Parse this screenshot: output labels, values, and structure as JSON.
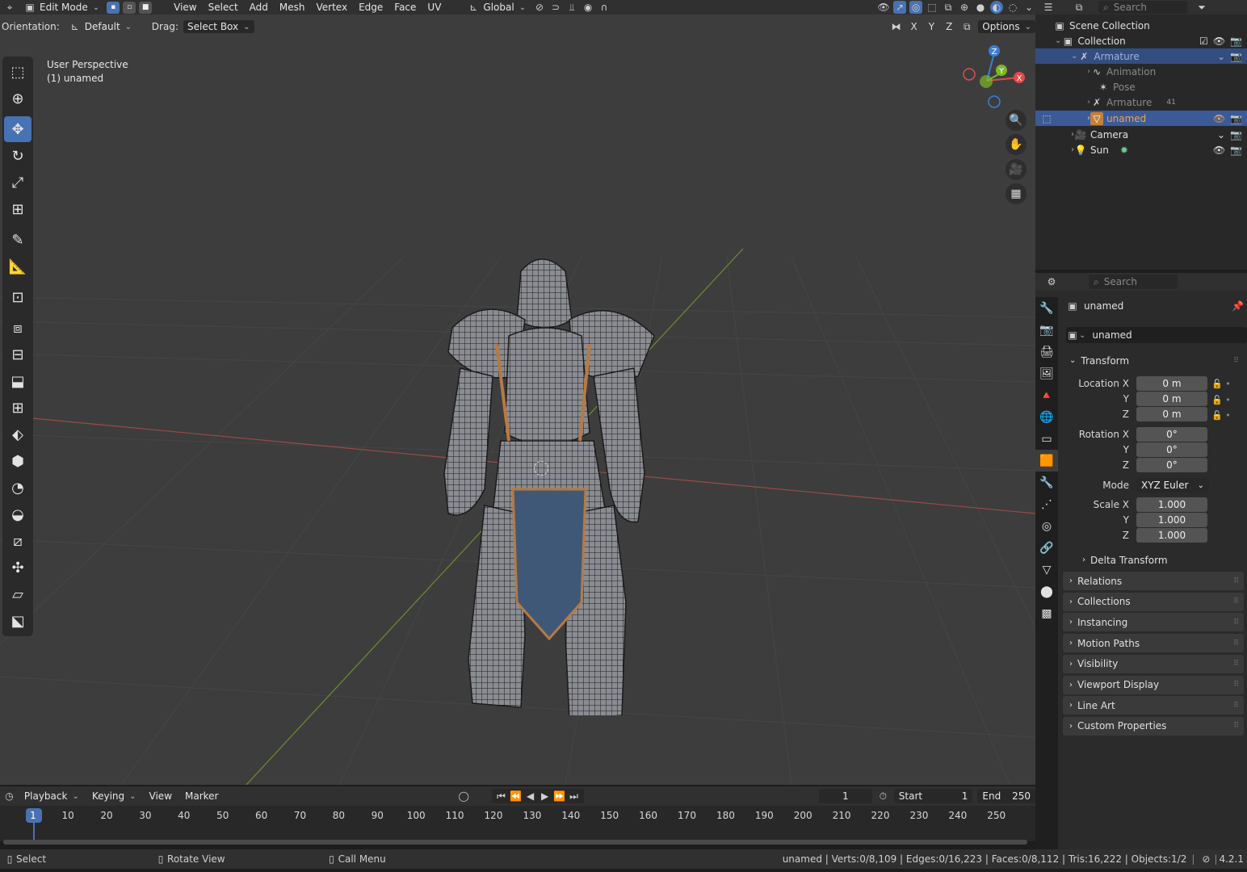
{
  "menu": {
    "mode": "Edit Mode",
    "items": [
      "View",
      "Select",
      "Add",
      "Mesh",
      "Vertex",
      "Edge",
      "Face",
      "UV"
    ],
    "transform_orientation": "Global"
  },
  "header2": {
    "orientation_label": "Orientation:",
    "orientation_value": "Default",
    "drag_label": "Drag:",
    "drag_value": "Select Box",
    "axes": [
      "X",
      "Y",
      "Z"
    ],
    "options": "Options"
  },
  "viewport": {
    "view_name": "User Perspective",
    "object_label": "(1) unamed",
    "gizmo": {
      "x": "X",
      "y": "Y",
      "z": "Z"
    }
  },
  "outliner": {
    "search_placeholder": "Search",
    "scene_collection": "Scene Collection",
    "collection": "Collection",
    "armature": "Armature",
    "animation": "Animation",
    "pose": "Pose",
    "armature_data": "Armature",
    "armature_count": "41",
    "object": "unamed",
    "camera": "Camera",
    "sun": "Sun"
  },
  "properties": {
    "search_placeholder": "Search",
    "object_name": "unamed",
    "datablock_name": "unamed",
    "transform_title": "Transform",
    "location_label": "Location X",
    "rotation_label": "Rotation X",
    "scale_label": "Scale X",
    "y": "Y",
    "z": "Z",
    "location": [
      "0 m",
      "0 m",
      "0 m"
    ],
    "rotation": [
      "0°",
      "0°",
      "0°"
    ],
    "mode_label": "Mode",
    "mode_value": "XYZ Euler",
    "scale": [
      "1.000",
      "1.000",
      "1.000"
    ],
    "delta_transform": "Delta Transform",
    "panels": [
      "Relations",
      "Collections",
      "Instancing",
      "Motion Paths",
      "Visibility",
      "Viewport Display",
      "Line Art",
      "Custom Properties"
    ]
  },
  "timeline": {
    "menus": [
      "Playback",
      "Keying",
      "View",
      "Marker"
    ],
    "current_frame": "1",
    "start_label": "Start",
    "start": "1",
    "end_label": "End",
    "end": "250",
    "ticks": [
      "1",
      "10",
      "20",
      "30",
      "40",
      "50",
      "60",
      "70",
      "80",
      "90",
      "100",
      "110",
      "120",
      "130",
      "140",
      "150",
      "160",
      "170",
      "180",
      "190",
      "200",
      "210",
      "220",
      "230",
      "240",
      "250"
    ]
  },
  "statusbar": {
    "select": "Select",
    "rotate": "Rotate View",
    "menu": "Call Menu",
    "stats": "unamed | Verts:0/8,109 | Edges:0/16,223 | Faces:0/8,112 | Tris:16,222 | Objects:1/2",
    "version": "4.2.1"
  },
  "colors": {
    "accent": "#4772b3",
    "viewport_bg": "#3d3d3d",
    "x_axis": "#e24a4a",
    "y_axis": "#7ab829",
    "z_axis": "#3a7fd6"
  }
}
